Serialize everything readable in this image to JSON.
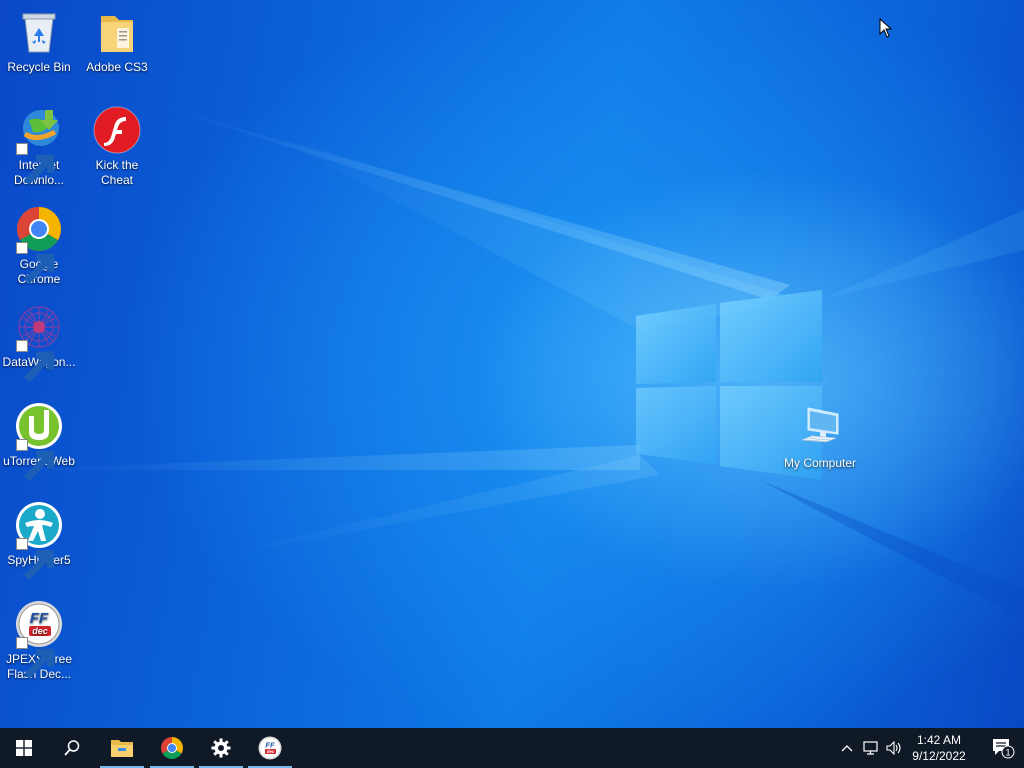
{
  "desktop": {
    "icons": [
      {
        "label": "Recycle Bin",
        "icon": "recycle-bin-icon"
      },
      {
        "label": "Adobe CS3",
        "icon": "folder-icon"
      },
      {
        "label": "Internet Downlo...",
        "icon": "internet-download-manager-icon"
      },
      {
        "label": "Kick the Cheat",
        "icon": "flash-player-icon"
      },
      {
        "label": "Google Chrome",
        "icon": "chrome-icon"
      },
      {
        "label": "DataWagon...",
        "icon": "datawagon-icon"
      },
      {
        "label": "uTorrent Web",
        "icon": "utorrent-icon"
      },
      {
        "label": "SpyHunter5",
        "icon": "spyhunter-icon"
      },
      {
        "label": "JPEXS Free Flash Dec...",
        "icon": "jpexs-ffdec-icon"
      },
      {
        "label": "My Computer",
        "icon": "my-computer-icon"
      }
    ]
  },
  "taskbar": {
    "pinned": [
      "start-icon",
      "search-icon",
      "file-explorer-icon",
      "chrome-icon",
      "settings-icon",
      "jpexs-ffdec-icon"
    ],
    "tray": [
      "chevron-up-icon",
      "network-icon",
      "volume-icon"
    ],
    "clock": {
      "time": "1:42 AM",
      "date": "9/12/2022"
    },
    "notifications": {
      "icon": "action-center-icon",
      "count": "1"
    }
  },
  "colors": {
    "desktop_blue": "#0b63da",
    "taskbar": "#101a26",
    "active_indicator": "#76b9ed"
  }
}
